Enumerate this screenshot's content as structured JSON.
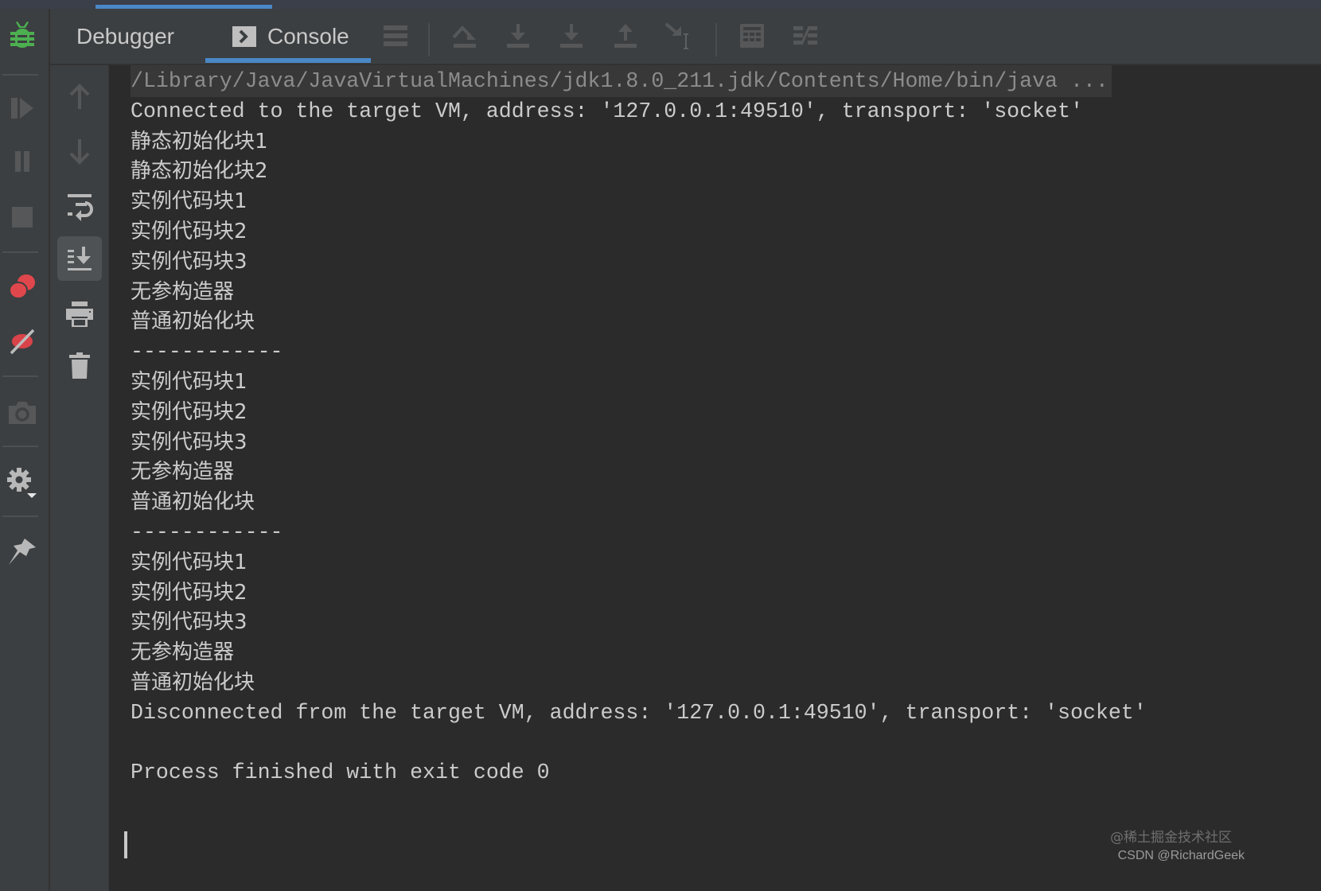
{
  "toolwindow": {
    "tabs": [
      {
        "label": "Debugger",
        "active": false
      },
      {
        "label": "Console",
        "active": true,
        "icon": "console-icon"
      }
    ],
    "toolbar": [
      {
        "name": "show-execution-point-icon"
      },
      {
        "name": "step-over-icon"
      },
      {
        "name": "step-into-icon"
      },
      {
        "name": "force-step-into-icon"
      },
      {
        "name": "step-out-icon"
      },
      {
        "name": "run-to-cursor-icon"
      },
      {
        "name": "evaluate-expression-icon"
      },
      {
        "name": "trace-current-stream-icon"
      }
    ]
  },
  "left_toolbar": [
    {
      "name": "debug-bug-icon",
      "color": "#4caf50"
    },
    {
      "name": "resume-program-icon"
    },
    {
      "name": "pause-program-icon"
    },
    {
      "name": "stop-icon"
    },
    {
      "name": "view-breakpoints-icon",
      "color": "#e0474c"
    },
    {
      "name": "mute-breakpoints-icon",
      "color": "#e0474c"
    },
    {
      "name": "get-thread-dump-icon"
    },
    {
      "name": "settings-icon"
    },
    {
      "name": "pin-tab-icon"
    }
  ],
  "console_toolbar": [
    {
      "name": "up-stack-trace-icon"
    },
    {
      "name": "down-stack-trace-icon"
    },
    {
      "name": "soft-wrap-icon"
    },
    {
      "name": "scroll-to-end-icon",
      "active": true
    },
    {
      "name": "print-icon"
    },
    {
      "name": "clear-all-icon"
    }
  ],
  "console": {
    "lines": [
      {
        "text": "/Library/Java/JavaVirtualMachines/jdk1.8.0_211.jdk/Contents/Home/bin/java ...",
        "kind": "cmd"
      },
      {
        "text": "Connected to the target VM, address: '127.0.0.1:49510', transport: 'socket'",
        "kind": "mono"
      },
      {
        "text": "静态初始化块1",
        "kind": "cjk"
      },
      {
        "text": "静态初始化块2",
        "kind": "cjk"
      },
      {
        "text": "实例代码块1",
        "kind": "cjk"
      },
      {
        "text": "实例代码块2",
        "kind": "cjk"
      },
      {
        "text": "实例代码块3",
        "kind": "cjk"
      },
      {
        "text": "无参构造器",
        "kind": "cjk"
      },
      {
        "text": "普通初始化块",
        "kind": "cjk"
      },
      {
        "text": "------------",
        "kind": "mono"
      },
      {
        "text": "实例代码块1",
        "kind": "cjk"
      },
      {
        "text": "实例代码块2",
        "kind": "cjk"
      },
      {
        "text": "实例代码块3",
        "kind": "cjk"
      },
      {
        "text": "无参构造器",
        "kind": "cjk"
      },
      {
        "text": "普通初始化块",
        "kind": "cjk"
      },
      {
        "text": "------------",
        "kind": "mono"
      },
      {
        "text": "实例代码块1",
        "kind": "cjk"
      },
      {
        "text": "实例代码块2",
        "kind": "cjk"
      },
      {
        "text": "实例代码块3",
        "kind": "cjk"
      },
      {
        "text": "无参构造器",
        "kind": "cjk"
      },
      {
        "text": "普通初始化块",
        "kind": "cjk"
      },
      {
        "text": "Disconnected from the target VM, address: '127.0.0.1:49510', transport: 'socket'",
        "kind": "mono"
      },
      {
        "text": "",
        "kind": "mono"
      },
      {
        "text": "Process finished with exit code 0",
        "kind": "mono"
      }
    ]
  },
  "watermark": {
    "line1": "@稀土掘金技术社区",
    "line2": "CSDN @RichardGeek"
  },
  "colors": {
    "accent": "#4a88c7",
    "background": "#2b2b2b",
    "panel": "#3c3f41",
    "text": "#cbcbcb"
  }
}
